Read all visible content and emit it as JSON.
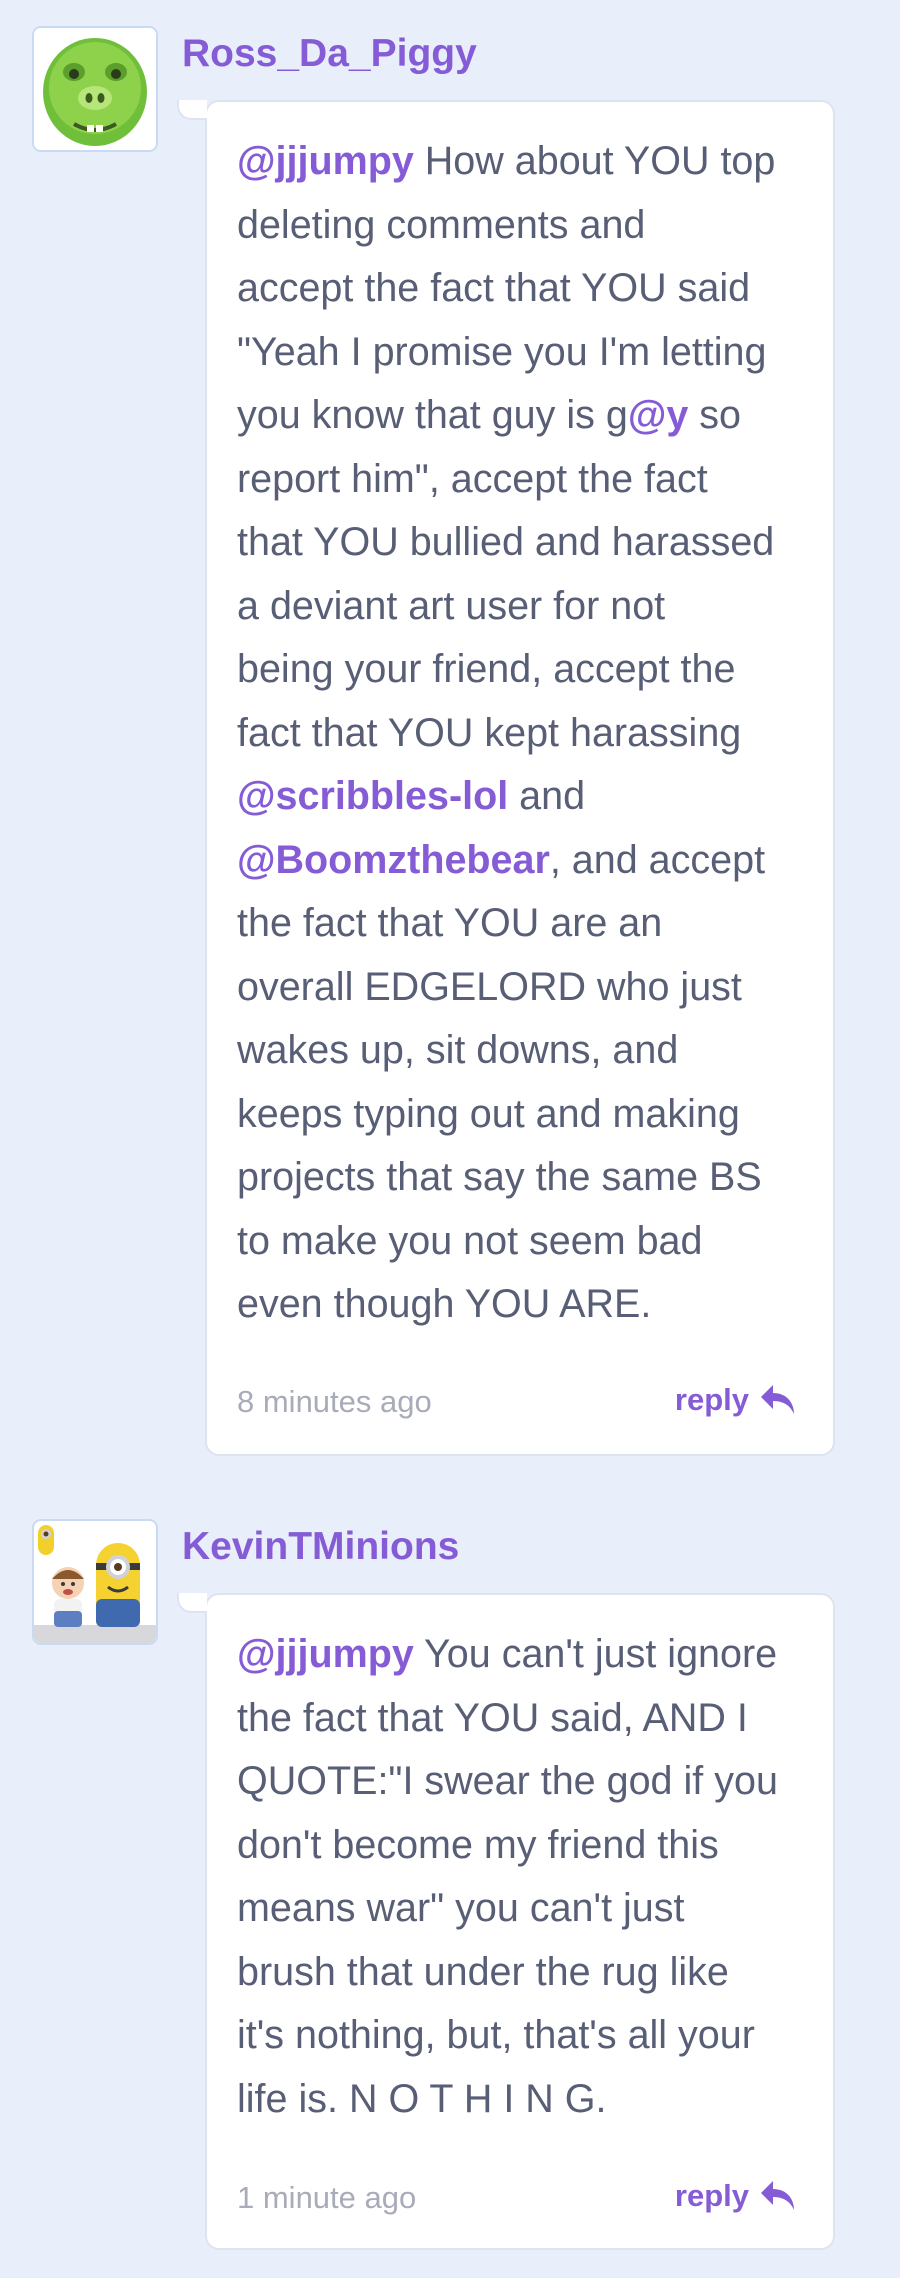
{
  "comments": [
    {
      "username": "Ross_Da_Piggy",
      "avatar_icon": "green-pig-avatar",
      "lines": [
        [
          {
            "t": "@jjjumpy",
            "m": true
          },
          {
            "t": " How about YOU top"
          }
        ],
        [
          {
            "t": "deleting comments and"
          }
        ],
        [
          {
            "t": "accept the fact that YOU said"
          }
        ],
        [
          {
            "t": "\"Yeah I promise you I'm letting"
          }
        ],
        [
          {
            "t": "you know that guy is g"
          },
          {
            "t": "@y",
            "m": true
          },
          {
            "t": " so"
          }
        ],
        [
          {
            "t": "report him\", accept the fact"
          }
        ],
        [
          {
            "t": "that YOU bullied and harassed"
          }
        ],
        [
          {
            "t": "a deviant art user for not"
          }
        ],
        [
          {
            "t": "being your friend, accept the"
          }
        ],
        [
          {
            "t": "fact that YOU kept harassing"
          }
        ],
        [
          {
            "t": "@scribbles-lol",
            "m": true
          },
          {
            "t": " and"
          }
        ],
        [
          {
            "t": "@Boomzthebear",
            "m": true
          },
          {
            "t": ", and accept"
          }
        ],
        [
          {
            "t": "the fact that YOU are an"
          }
        ],
        [
          {
            "t": "overall EDGELORD who just"
          }
        ],
        [
          {
            "t": "wakes up, sit downs, and"
          }
        ],
        [
          {
            "t": "keeps typing out and making"
          }
        ],
        [
          {
            "t": "projects that say the same BS"
          }
        ],
        [
          {
            "t": "to make you not seem bad"
          }
        ],
        [
          {
            "t": "even though YOU ARE."
          }
        ]
      ],
      "time": "8 minutes ago",
      "reply_label": "reply"
    },
    {
      "username": "KevinTMinions",
      "avatar_icon": "minion-avatar",
      "lines": [
        [
          {
            "t": "@jjjumpy",
            "m": true
          },
          {
            "t": " You can't just ignore"
          }
        ],
        [
          {
            "t": "the fact that YOU said, AND I"
          }
        ],
        [
          {
            "t": "QUOTE:\"I swear the god if you"
          }
        ],
        [
          {
            "t": "don't become my friend this"
          }
        ],
        [
          {
            "t": "means war\" you can't just"
          }
        ],
        [
          {
            "t": "brush that under the rug like"
          }
        ],
        [
          {
            "t": "it's nothing, but, that's all your"
          }
        ],
        [
          {
            "t": "life is. N O T H I N G."
          }
        ]
      ],
      "time": "1 minute ago",
      "reply_label": "reply"
    }
  ],
  "colors": {
    "background": "#e9effa",
    "accent": "#855cd6",
    "text": "#575e75",
    "muted": "#a8acb8"
  }
}
